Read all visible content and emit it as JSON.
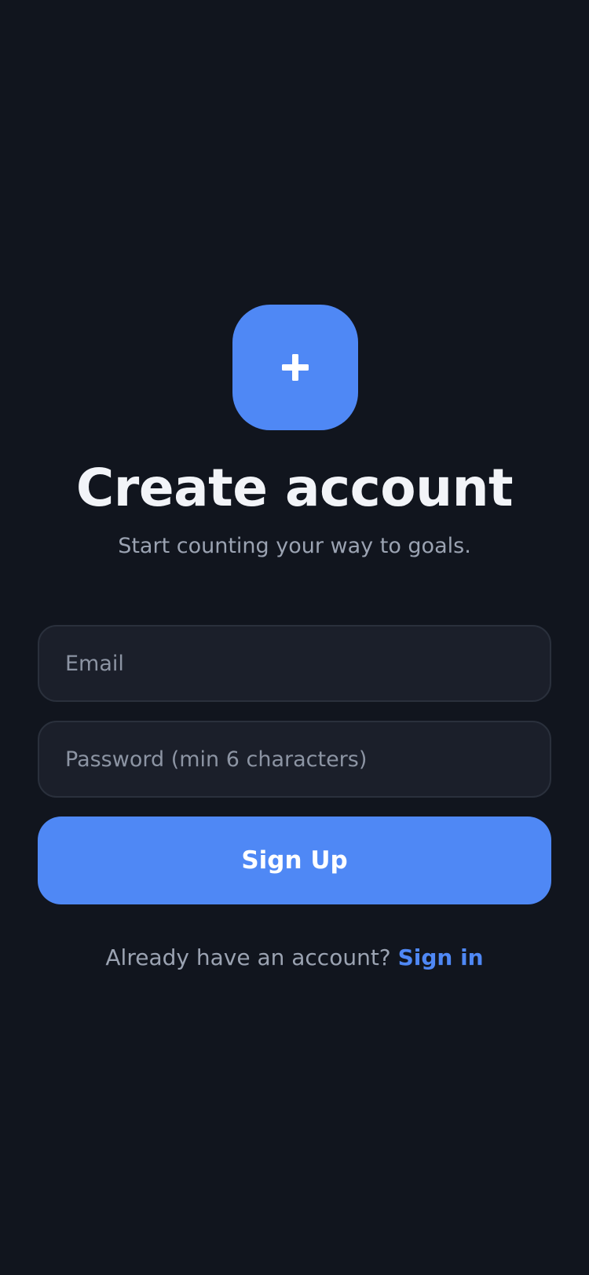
{
  "app_icon": {
    "icon": "plus-icon",
    "background": "#4f88f5"
  },
  "header": {
    "title": "Create account",
    "subtitle": "Start counting your way to goals."
  },
  "form": {
    "email": {
      "placeholder": "Email",
      "value": ""
    },
    "password": {
      "placeholder": "Password (min 6 characters)",
      "value": ""
    },
    "submit_label": "Sign Up"
  },
  "footer": {
    "prompt": "Already have an account? ",
    "link_label": "Sign in"
  },
  "colors": {
    "background": "#11151e",
    "accent": "#4f88f5",
    "input_background": "#1b1f2a",
    "input_border": "#2a303c",
    "muted_text": "#9ba3b2",
    "title_text": "#f2f4f8"
  }
}
